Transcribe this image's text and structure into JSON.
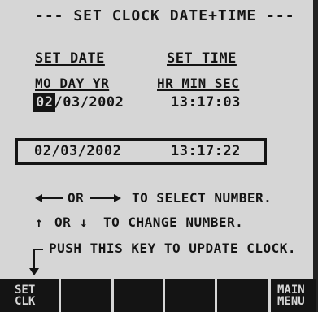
{
  "title": "--- SET CLOCK DATE+TIME ---",
  "set_date_label": "SET DATE",
  "set_time_label": "SET TIME",
  "date_fields_label": "MO DAY YR",
  "time_fields_label": "HR MIN SEC",
  "date_value": {
    "month": "02",
    "rest": "/03/2002"
  },
  "time_value": "13:17:03",
  "current_clock": {
    "date": "02/03/2002",
    "time": "13:17:22"
  },
  "help": {
    "select_or": "OR",
    "select_text": "TO SELECT NUMBER.",
    "change_or": "OR",
    "change_text": "TO CHANGE NUMBER.",
    "push_text": "PUSH THIS KEY TO UPDATE CLOCK."
  },
  "softkeys": [
    {
      "line1": "SET",
      "line2": "CLK"
    },
    {
      "line1": "",
      "line2": ""
    },
    {
      "line1": "",
      "line2": ""
    },
    {
      "line1": "",
      "line2": ""
    },
    {
      "line1": "",
      "line2": ""
    },
    {
      "line1": "MAIN",
      "line2": "MENU"
    }
  ],
  "icons": {
    "left_arrow": "left-arrow-icon",
    "right_arrow": "right-arrow-icon",
    "up_arrow": "up-arrow-icon",
    "down_arrow": "down-arrow-icon",
    "push_arrow": "bent-down-arrow-icon"
  }
}
